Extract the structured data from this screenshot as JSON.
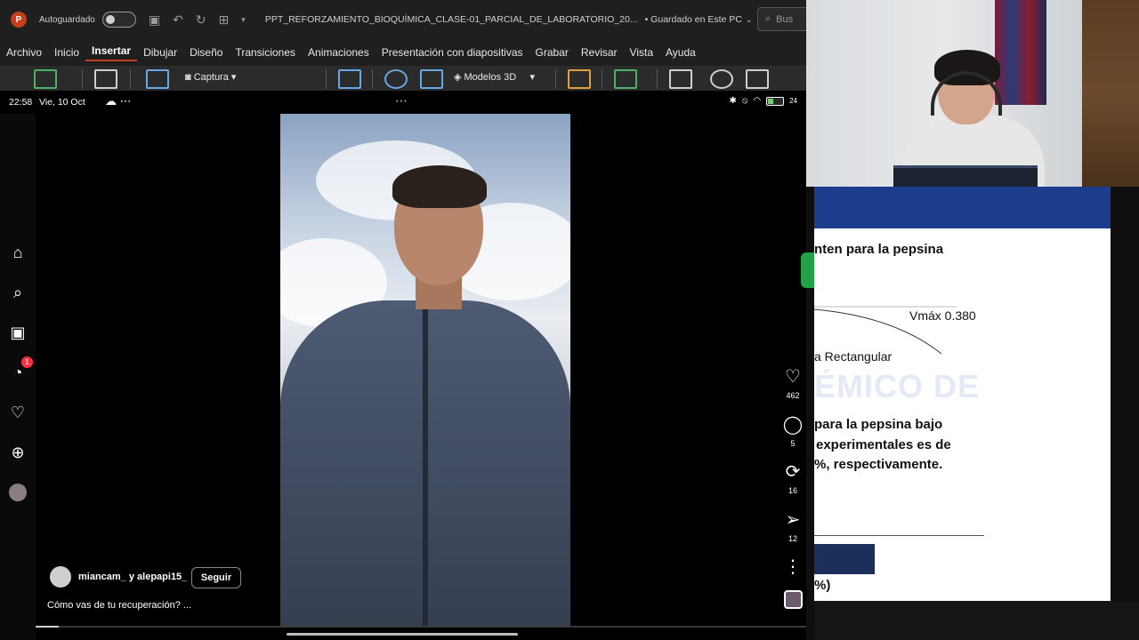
{
  "ppt": {
    "autosave_label": "Autoguardado",
    "doc_title": "PPT_REFORZAMIENTO_BIOQUÍMICA_CLASE-01_PARCIAL_DE_LABORATORIO_20...",
    "saved_status": "• Guardado en Este PC",
    "search_placeholder": "Bus",
    "menu": [
      "Archivo",
      "Inicio",
      "Insertar",
      "Dibujar",
      "Diseño",
      "Transiciones",
      "Animaciones",
      "Presentación con diapositivas",
      "Grabar",
      "Revisar",
      "Vista",
      "Ayuda"
    ],
    "active_menu": "Insertar",
    "ribbon": {
      "capture_label": "Captura",
      "models3d_label": "Modelos 3D"
    }
  },
  "phone": {
    "time": "22:58",
    "date": "Vie, 10 Oct",
    "battery": "24"
  },
  "nav": {
    "messenger_badge": "1"
  },
  "post": {
    "users": "miancam_ y alepapi15_",
    "follow_label": "Seguir",
    "caption": "Cómo vas de tu recuperación? ...",
    "likes": "462",
    "comments": "5",
    "reposts": "16",
    "shares": "12",
    "progress": 0.03
  },
  "slide": {
    "line1": "nten para la pepsina",
    "vmax": "Vmáx 0.380",
    "rect": "a Rectangular",
    "ghost": "ÉMICO DE",
    "para1": "para la pepsina bajo",
    "para2": "experimentales es de",
    "para3": "%, respectivamente.",
    "bottom": "%)"
  }
}
